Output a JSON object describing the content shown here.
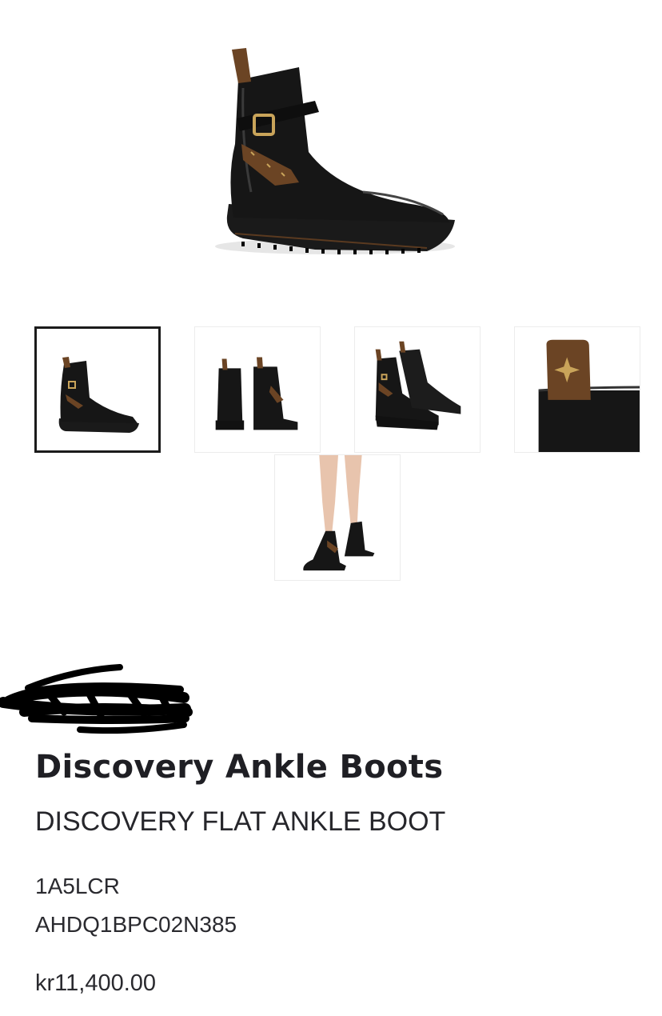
{
  "product": {
    "name": "Discovery Ankle Boots",
    "subtitle": "DISCOVERY FLAT ANKLE BOOT",
    "sku": "1A5LCR",
    "variant_code": "AHDQ1BPC02N385",
    "price": "kr11,400.00"
  },
  "gallery": {
    "selected_index": 0,
    "thumbnails": [
      {
        "name": "side-view",
        "icon": "boot-side-image"
      },
      {
        "name": "back-view",
        "icon": "boot-pair-back-image"
      },
      {
        "name": "three-quarter-view",
        "icon": "boot-pair-angle-image"
      },
      {
        "name": "pull-tab-detail",
        "icon": "monogram-tab-detail-image"
      },
      {
        "name": "worn-view",
        "icon": "boots-on-model-image"
      }
    ]
  },
  "colors": {
    "leather": "#161616",
    "monogram": "#6b4424",
    "buckle": "#c9a45a",
    "selected_border": "#1b1b1b",
    "text": "#1f1f24"
  }
}
